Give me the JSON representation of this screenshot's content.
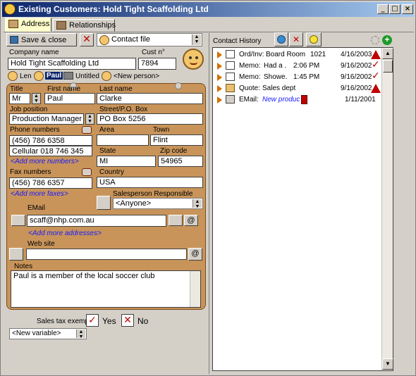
{
  "window": {
    "title": "Existing Customers: Hold Tight Scaffolding Ltd",
    "minimize": "_",
    "maximize": "□",
    "close": "×"
  },
  "tabs": [
    {
      "label": "Address"
    },
    {
      "label": "Relationships"
    }
  ],
  "toolbar": {
    "save_close": "Save & close",
    "contact_file": "Contact file"
  },
  "company": {
    "label": "Company name",
    "value": "Hold Tight Scaffolding Ltd",
    "cust_label": "Cust n°",
    "cust_value": "7894"
  },
  "people": {
    "p1": "Len",
    "p2": "Paul",
    "p3": "Untitled",
    "new_person": "<New person>"
  },
  "person": {
    "title_label": "Title",
    "title_value": "Mr",
    "first_label": "First name",
    "first_value": "Paul",
    "last_label": "Last name",
    "last_value": "Clarke",
    "job_label": "Job position",
    "job_value": "Production Manager",
    "street_label": "Street/P.O. Box",
    "street_value": "PO Box 5256",
    "phone_label": "Phone numbers",
    "phone1": "(456) 786 6358",
    "phone2": "Cellular 018 746 345",
    "add_numbers": "<Add more numbers>",
    "area_label": "Area",
    "area_value": "",
    "town_label": "Town",
    "town_value": "Flint",
    "state_label": "State",
    "state_value": "MI",
    "zip_label": "Zip code",
    "zip_value": "54965",
    "fax_label": "Fax numbers",
    "fax_value": "(456) 786 6357",
    "add_faxes": "<Add more faxes>",
    "country_label": "Country",
    "country_value": "USA",
    "sales_label": "Salesperson Responsible",
    "sales_value": "<Anyone>",
    "email_label": "EMail",
    "email_value": "scaff@nhp.com.au",
    "add_addresses": "<Add more addresses>",
    "web_label": "Web site",
    "web_value": "",
    "notes_label": "Notes",
    "notes_value": "Paul is a member of the local soccer club"
  },
  "tax": {
    "label": "Sales tax exempt",
    "yes": "Yes",
    "no": "No"
  },
  "new_variable": "<New variable>",
  "history": {
    "label": "Contact History",
    "rows": [
      {
        "type": "Ord/Inv:",
        "desc": "Board Room",
        "extra": "1021",
        "date": "4/16/2003",
        "status": "warning"
      },
      {
        "type": "Memo:",
        "desc": "Had a .",
        "extra": "2:06 PM",
        "date": "9/16/2002",
        "status": "done"
      },
      {
        "type": "Memo:",
        "desc": "Showe.",
        "extra": "1:45 PM",
        "date": "9/16/2002",
        "status": "done"
      },
      {
        "type": "Quote:",
        "desc": "Sales dept",
        "extra": "",
        "date": "9/16/2002",
        "status": "warning"
      },
      {
        "type": "EMail:",
        "desc": "New produc",
        "extra": "",
        "date": "1/11/2001",
        "status": "none"
      }
    ]
  }
}
